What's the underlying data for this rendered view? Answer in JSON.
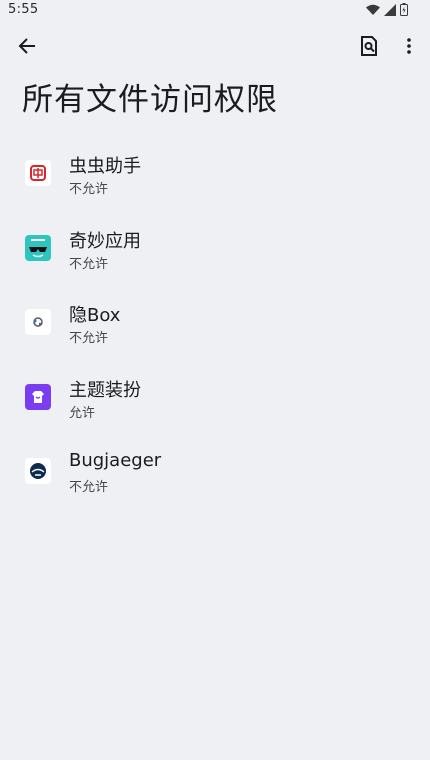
{
  "status_bar": {
    "time": "5:55"
  },
  "page": {
    "title": "所有文件访问权限"
  },
  "apps": [
    {
      "name": "虫虫助手",
      "status": "不允许",
      "icon": "chongchong-icon"
    },
    {
      "name": "奇妙应用",
      "status": "不允许",
      "icon": "magic-icon"
    },
    {
      "name": "隐Box",
      "status": "不允许",
      "icon": "yinbox-icon"
    },
    {
      "name": "主题装扮",
      "status": "允许",
      "icon": "theme-icon"
    },
    {
      "name": "Bugjaeger",
      "status": "不允许",
      "icon": "bugjaeger-icon"
    }
  ],
  "colors": {
    "background": "#eff0f4",
    "text_primary": "#1b1c1f",
    "text_secondary": "#45474b",
    "magic_teal": "#2ec5c0",
    "theme_purple": "#7b3df0",
    "chongchong_red": "#d9262b",
    "bugjaeger_navy": "#0d2a4f"
  }
}
